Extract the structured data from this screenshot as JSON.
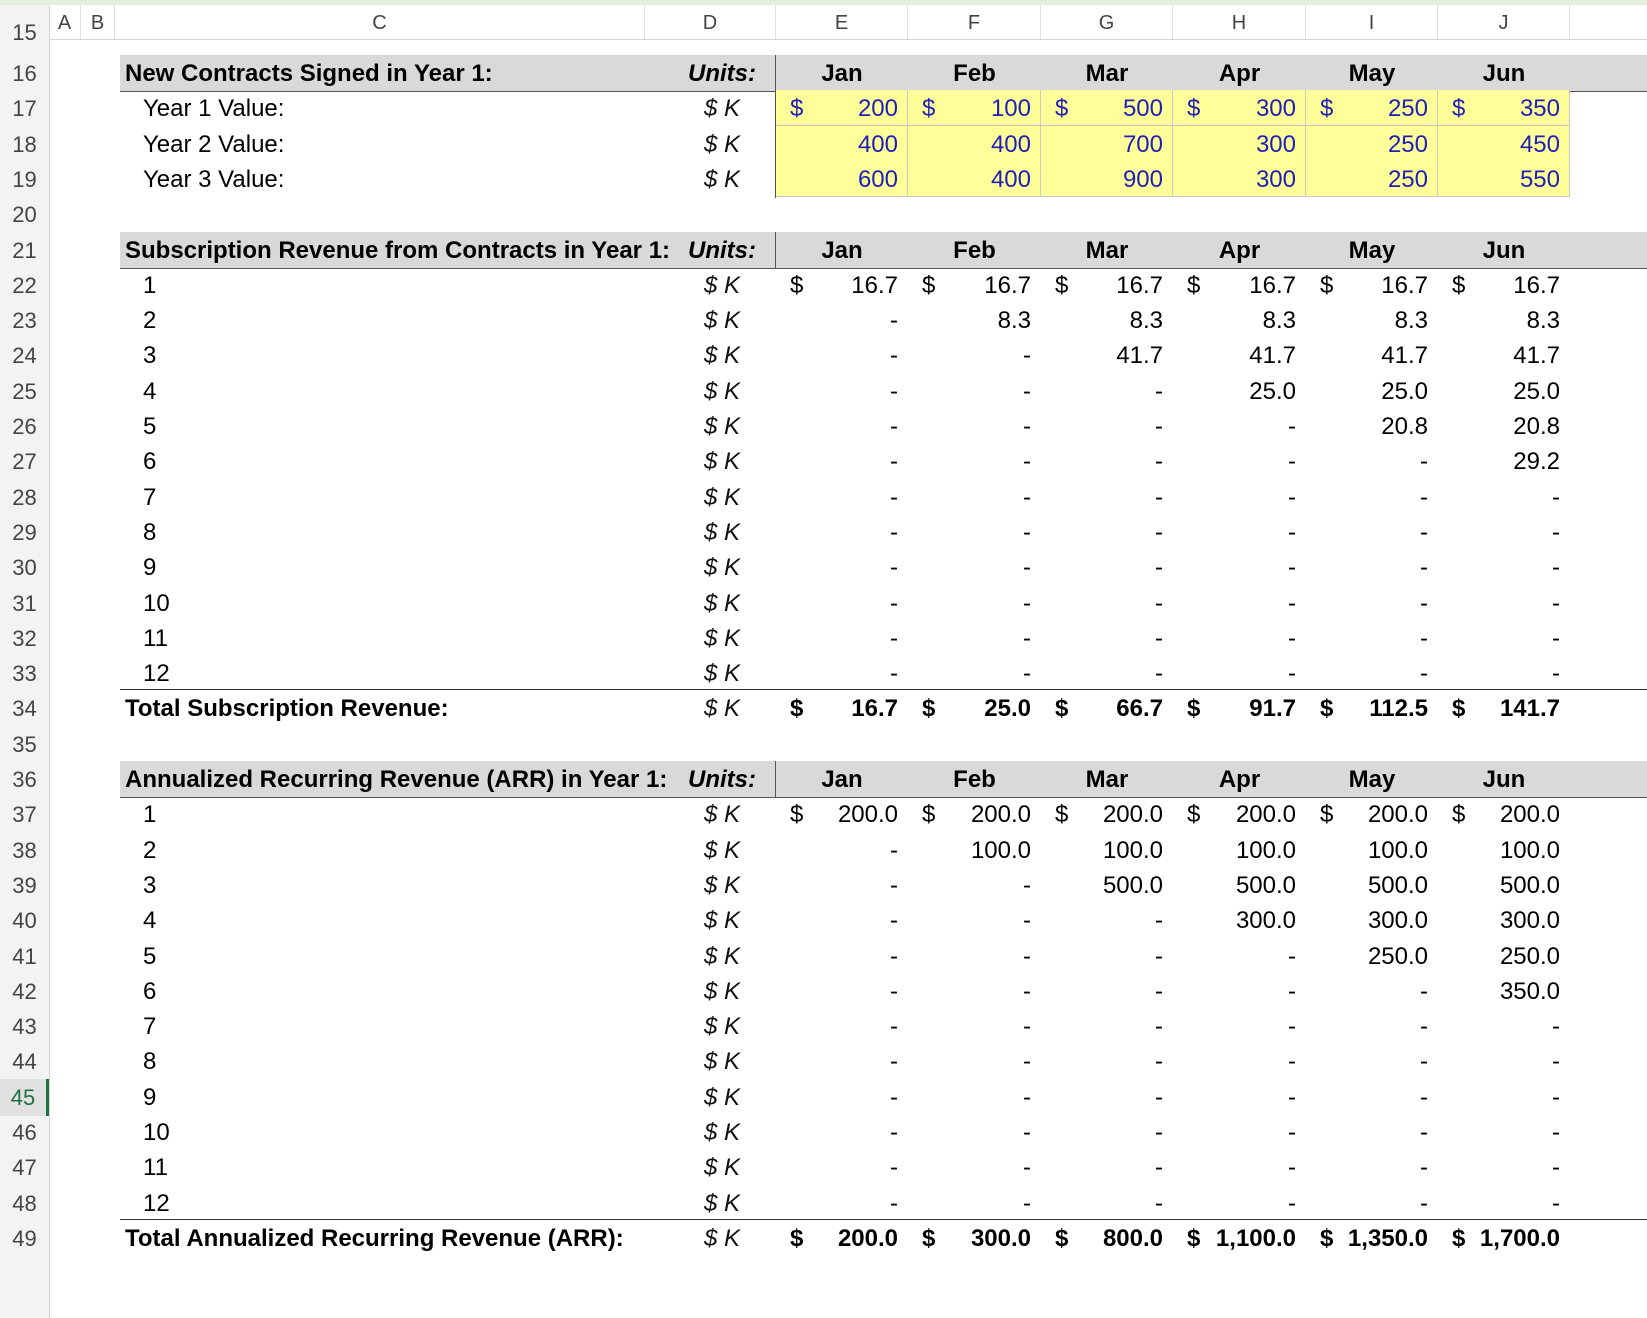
{
  "sheet": {
    "columns": [
      "A",
      "B",
      "C",
      "D",
      "E",
      "F",
      "G",
      "H",
      "I",
      "J"
    ],
    "first_row_partial": "15",
    "active_row": "45",
    "months": [
      "Jan",
      "Feb",
      "Mar",
      "Apr",
      "May",
      "Jun"
    ],
    "units_header": "Units:",
    "units_value": "$ K",
    "dollar": "$",
    "input_color": "#1f1fb8",
    "input_fill": "#ffff99",
    "header_fill": "#d9d9d9"
  },
  "sections": [
    {
      "key": "contracts",
      "header_row": 16,
      "title": "New Contracts Signed in Year 1:",
      "rows": [
        {
          "row": 17,
          "label": "Year 1 Value:",
          "dollar": true,
          "input": true,
          "values": [
            "200",
            "100",
            "500",
            "300",
            "250",
            "350"
          ]
        },
        {
          "row": 18,
          "label": "Year 2 Value:",
          "dollar": false,
          "input": true,
          "values": [
            "400",
            "400",
            "700",
            "300",
            "250",
            "450"
          ]
        },
        {
          "row": 19,
          "label": "Year 3 Value:",
          "dollar": false,
          "input": true,
          "values": [
            "600",
            "400",
            "900",
            "300",
            "250",
            "550"
          ]
        }
      ]
    },
    {
      "key": "subscription",
      "header_row": 21,
      "title": "Subscription Revenue from Contracts in Year 1:",
      "rows": [
        {
          "row": 22,
          "label": "1",
          "dollar": true,
          "values": [
            "16.7",
            "16.7",
            "16.7",
            "16.7",
            "16.7",
            "16.7"
          ]
        },
        {
          "row": 23,
          "label": "2",
          "values": [
            "-",
            "8.3",
            "8.3",
            "8.3",
            "8.3",
            "8.3"
          ]
        },
        {
          "row": 24,
          "label": "3",
          "values": [
            "-",
            "-",
            "41.7",
            "41.7",
            "41.7",
            "41.7"
          ]
        },
        {
          "row": 25,
          "label": "4",
          "values": [
            "-",
            "-",
            "-",
            "25.0",
            "25.0",
            "25.0"
          ]
        },
        {
          "row": 26,
          "label": "5",
          "values": [
            "-",
            "-",
            "-",
            "-",
            "20.8",
            "20.8"
          ]
        },
        {
          "row": 27,
          "label": "6",
          "values": [
            "-",
            "-",
            "-",
            "-",
            "-",
            "29.2"
          ]
        },
        {
          "row": 28,
          "label": "7",
          "values": [
            "-",
            "-",
            "-",
            "-",
            "-",
            "-"
          ]
        },
        {
          "row": 29,
          "label": "8",
          "values": [
            "-",
            "-",
            "-",
            "-",
            "-",
            "-"
          ]
        },
        {
          "row": 30,
          "label": "9",
          "values": [
            "-",
            "-",
            "-",
            "-",
            "-",
            "-"
          ]
        },
        {
          "row": 31,
          "label": "10",
          "values": [
            "-",
            "-",
            "-",
            "-",
            "-",
            "-"
          ]
        },
        {
          "row": 32,
          "label": "11",
          "values": [
            "-",
            "-",
            "-",
            "-",
            "-",
            "-"
          ]
        },
        {
          "row": 33,
          "label": "12",
          "values": [
            "-",
            "-",
            "-",
            "-",
            "-",
            "-"
          ]
        }
      ],
      "total": {
        "row": 34,
        "label": "Total Subscription Revenue:",
        "values": [
          "16.7",
          "25.0",
          "66.7",
          "91.7",
          "112.5",
          "141.7"
        ]
      }
    },
    {
      "key": "arr",
      "header_row": 36,
      "title": "Annualized Recurring Revenue (ARR) in Year 1:",
      "rows": [
        {
          "row": 37,
          "label": "1",
          "dollar": true,
          "values": [
            "200.0",
            "200.0",
            "200.0",
            "200.0",
            "200.0",
            "200.0"
          ]
        },
        {
          "row": 38,
          "label": "2",
          "values": [
            "-",
            "100.0",
            "100.0",
            "100.0",
            "100.0",
            "100.0"
          ]
        },
        {
          "row": 39,
          "label": "3",
          "values": [
            "-",
            "-",
            "500.0",
            "500.0",
            "500.0",
            "500.0"
          ]
        },
        {
          "row": 40,
          "label": "4",
          "values": [
            "-",
            "-",
            "-",
            "300.0",
            "300.0",
            "300.0"
          ]
        },
        {
          "row": 41,
          "label": "5",
          "values": [
            "-",
            "-",
            "-",
            "-",
            "250.0",
            "250.0"
          ]
        },
        {
          "row": 42,
          "label": "6",
          "values": [
            "-",
            "-",
            "-",
            "-",
            "-",
            "350.0"
          ]
        },
        {
          "row": 43,
          "label": "7",
          "values": [
            "-",
            "-",
            "-",
            "-",
            "-",
            "-"
          ]
        },
        {
          "row": 44,
          "label": "8",
          "values": [
            "-",
            "-",
            "-",
            "-",
            "-",
            "-"
          ]
        },
        {
          "row": 45,
          "label": "9",
          "values": [
            "-",
            "-",
            "-",
            "-",
            "-",
            "-"
          ]
        },
        {
          "row": 46,
          "label": "10",
          "values": [
            "-",
            "-",
            "-",
            "-",
            "-",
            "-"
          ]
        },
        {
          "row": 47,
          "label": "11",
          "values": [
            "-",
            "-",
            "-",
            "-",
            "-",
            "-"
          ]
        },
        {
          "row": 48,
          "label": "12",
          "values": [
            "-",
            "-",
            "-",
            "-",
            "-",
            "-"
          ]
        }
      ],
      "total": {
        "row": 49,
        "label": "Total Annualized Recurring Revenue (ARR):",
        "values": [
          "200.0",
          "300.0",
          "800.0",
          "1,100.0",
          "1,350.0",
          "1,700.0"
        ]
      }
    }
  ]
}
